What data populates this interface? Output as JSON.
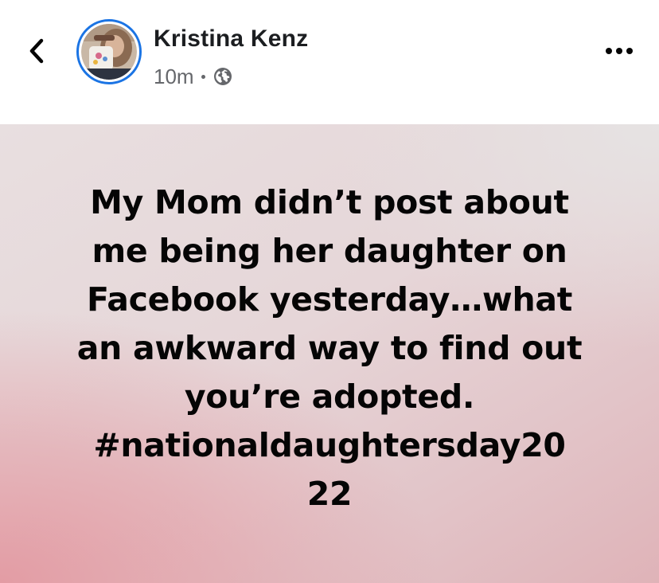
{
  "post": {
    "author_name": "Kristina Kenz",
    "timestamp": "10m",
    "separator": "·",
    "privacy_icon": "globe-icon",
    "back_icon": "chevron-left-icon",
    "more_icon": "more-horizontal-icon",
    "text_lines": [
      "My Mom didn’t post about",
      "me being her daughter on",
      "Facebook yesterday…what",
      "an awkward way to find out",
      "you’re adopted.",
      "#nationaldaughtersday20",
      "22"
    ],
    "colors": {
      "story_ring": "#1b74e4",
      "name": "#1c1e21",
      "meta": "#65676b",
      "bg_pink": "#e39ca4",
      "bg_light": "#e6e3e3"
    }
  }
}
